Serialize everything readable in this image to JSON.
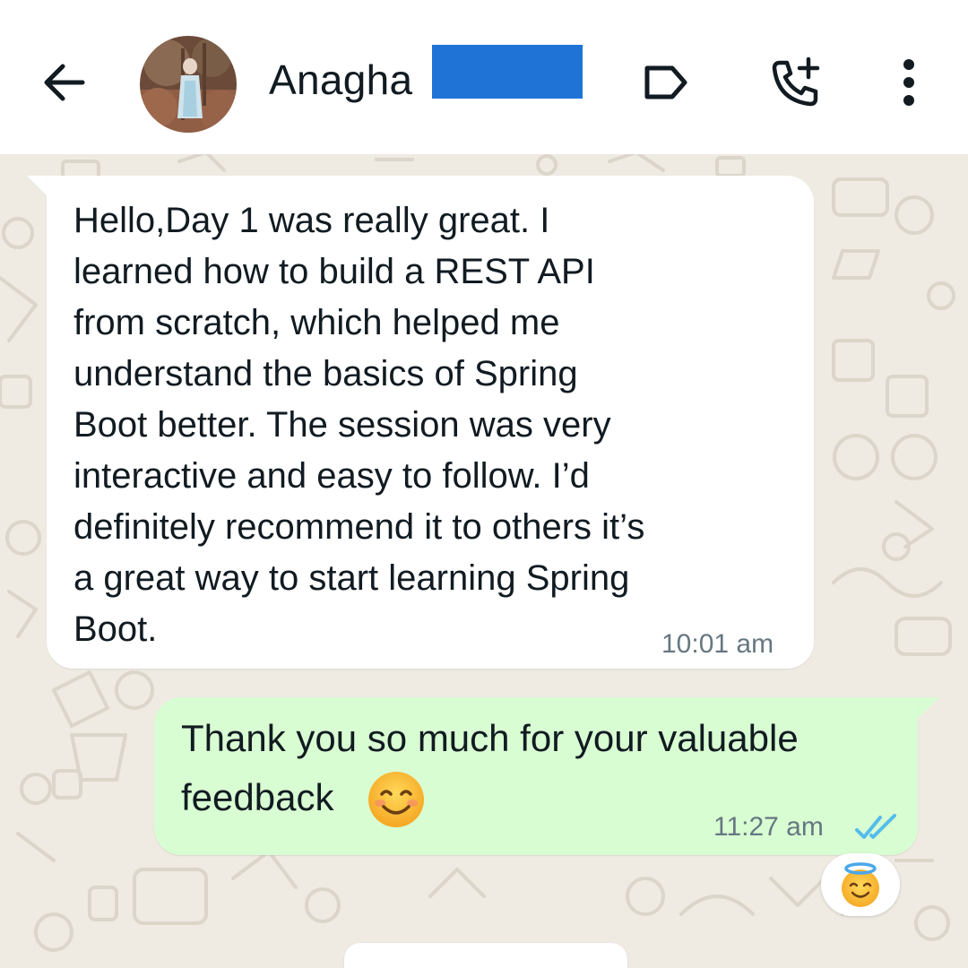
{
  "header": {
    "contact_name": "Anagha",
    "icons": [
      "back-arrow-icon",
      "label-tag-icon",
      "add-call-icon",
      "more-vert-icon"
    ]
  },
  "messages": [
    {
      "direction": "incoming",
      "text": "Hello,Day 1 was really great. I\nlearned how to build a REST API\nfrom scratch, which helped me\nunderstand the basics of Spring\nBoot better. The session was very\ninteractive and easy to follow. I’d\ndefinitely recommend it to others  it’s\na great way to start learning Spring\nBoot.",
      "time": "10:01 am"
    },
    {
      "direction": "outgoing",
      "text_line1": "Thank you so much for your valuable",
      "text_line2": "feedback",
      "emoji": "smiling-face-icon",
      "time": "11:27 am",
      "status": "read",
      "reaction": "smiling-face-with-halo-icon"
    }
  ],
  "colors": {
    "wallpaper": "#efeae2",
    "incoming_bubble": "#ffffff",
    "outgoing_bubble": "#d9fdd3",
    "read_tick": "#53bdeb",
    "redaction": "#1f73d6"
  }
}
